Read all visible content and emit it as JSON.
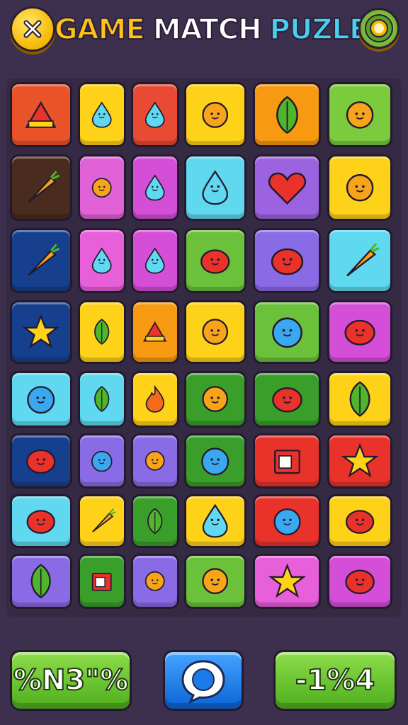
{
  "header": {
    "close_icon": "close-x-icon",
    "title_part1": "GAME",
    "title_part2": "MATCH",
    "title_part3": "PUZLE",
    "settings_icon": "gear-icon"
  },
  "bottom_bar": {
    "left_label": "%N3\"%",
    "center_icon": "chat-bubble-icon",
    "right_label": "-1%4"
  },
  "board": {
    "rows": [
      [
        {
          "icon": "circus-tent-icon",
          "color": "#e8532a"
        },
        {
          "icon": "lightbulb-icon",
          "color": "#ffd21a"
        },
        {
          "icon": "cup-icon",
          "color": "#e84a33"
        },
        {
          "icon": "red-flower-icon",
          "color": "#ffd21a"
        },
        {
          "icon": "leaf-icon",
          "color": "#f79a12"
        },
        {
          "icon": "blue-sun-icon",
          "color": "#7ccb3c"
        }
      ],
      [
        {
          "icon": "carrot-icon",
          "color": "#4a2c1e"
        },
        {
          "icon": "sun-face-icon",
          "color": "#e062d6"
        },
        {
          "icon": "lemon-face-icon",
          "color": "#d44ed8"
        },
        {
          "icon": "pin-icon",
          "color": "#5fd8f0"
        },
        {
          "icon": "heart-icon",
          "color": "#9b63e0"
        },
        {
          "icon": "sun-icon",
          "color": "#ffd21a"
        }
      ],
      [
        {
          "icon": "figure-icon",
          "color": "#163f8e"
        },
        {
          "icon": "bottle-icon",
          "color": "#e75fd9"
        },
        {
          "icon": "drop-face-icon",
          "color": "#d44ed8"
        },
        {
          "icon": "berry-icon",
          "color": "#6bc23a"
        },
        {
          "icon": "ladybug-icon",
          "color": "#8a6be6"
        },
        {
          "icon": "carrots-icon",
          "color": "#5fd8f0"
        }
      ],
      [
        {
          "icon": "star-icon",
          "color": "#163f8e"
        },
        {
          "icon": "green-leaf-icon",
          "color": "#ffd21a"
        },
        {
          "icon": "tent-icon",
          "color": "#f79a12"
        },
        {
          "icon": "flower-face-icon",
          "color": "#ffd21a"
        },
        {
          "icon": "bird-icon",
          "color": "#6bc23a"
        },
        {
          "icon": "deer-icon",
          "color": "#d44ed8"
        }
      ],
      [
        {
          "icon": "olive-icon",
          "color": "#5fd8f0"
        },
        {
          "icon": "plant-icon",
          "color": "#5fd8f0"
        },
        {
          "icon": "flame-icon",
          "color": "#ffd21a"
        },
        {
          "icon": "orange-sun-icon",
          "color": "#3a9e2a"
        },
        {
          "icon": "apple-icon",
          "color": "#3a9e2a"
        },
        {
          "icon": "leaves-icon",
          "color": "#ffd21a"
        }
      ],
      [
        {
          "icon": "red-blob-icon",
          "color": "#163f8e"
        },
        {
          "icon": "chat-icon",
          "color": "#8a6be6"
        },
        {
          "icon": "small-sun-icon",
          "color": "#8a6be6"
        },
        {
          "icon": "spiral-icon",
          "color": "#3a9e2a"
        },
        {
          "icon": "jar-icon",
          "color": "#e8322a"
        },
        {
          "icon": "green-star-icon",
          "color": "#e8322a"
        }
      ],
      [
        {
          "icon": "red-virus-icon",
          "color": "#5fd8f0"
        },
        {
          "icon": "candy-stick-icon",
          "color": "#ffd21a"
        },
        {
          "icon": "tree-icon",
          "color": "#3a9e2a"
        },
        {
          "icon": "pink-blob-icon",
          "color": "#ffd21a"
        },
        {
          "icon": "blue-ball-icon",
          "color": "#e8322a"
        },
        {
          "icon": "purple-virus-icon",
          "color": "#ffd21a"
        }
      ],
      [
        {
          "icon": "herb-icon",
          "color": "#8a6be6"
        },
        {
          "icon": "box-icon",
          "color": "#3a9e2a"
        },
        {
          "icon": "orange-sun-face-icon",
          "color": "#8a6be6"
        },
        {
          "icon": "pink-flower-icon",
          "color": "#6bc23a"
        },
        {
          "icon": "yellow-star-flower-icon",
          "color": "#e75fd9"
        },
        {
          "icon": "cat-face-icon",
          "color": "#d44ed8"
        }
      ]
    ]
  }
}
